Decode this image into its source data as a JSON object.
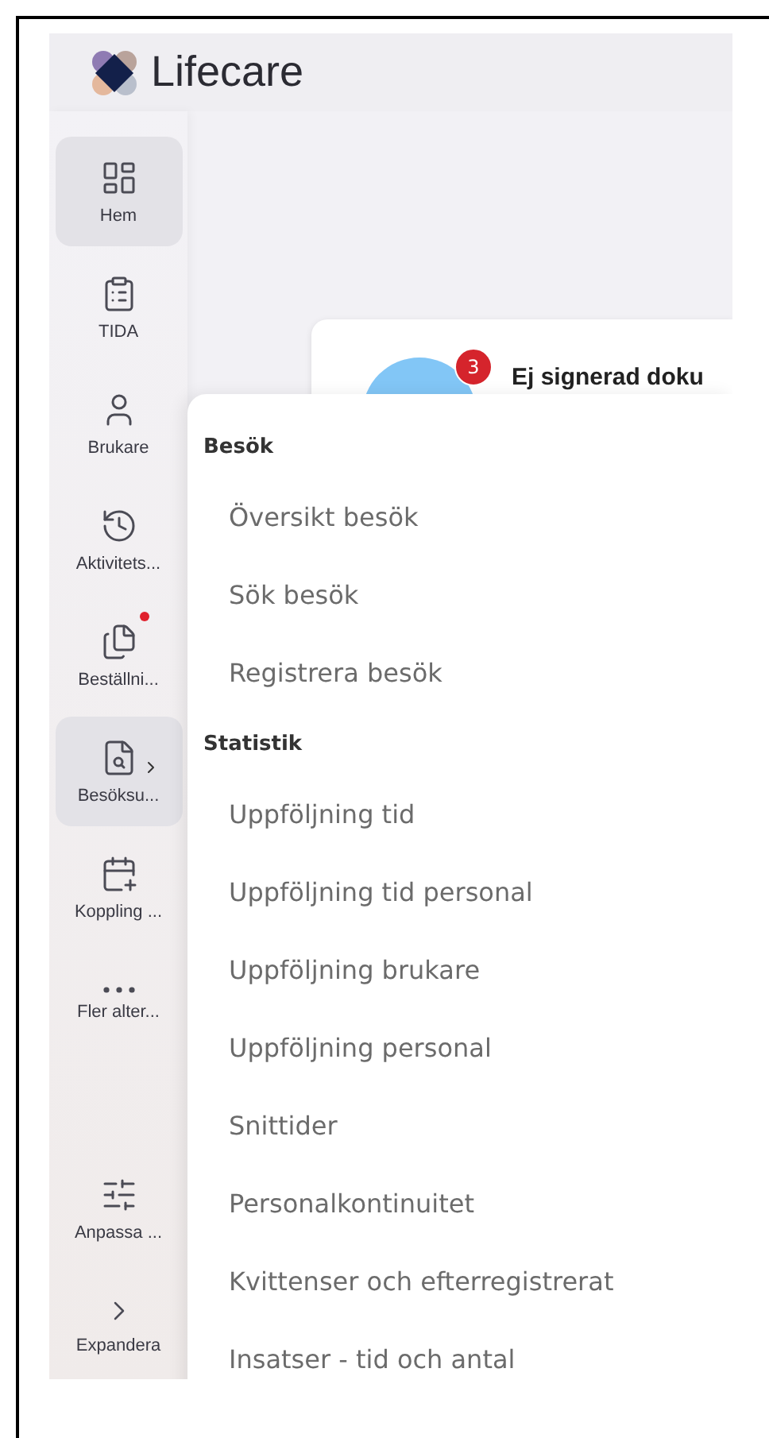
{
  "header": {
    "logo_text": "Lifecare"
  },
  "sidebar": {
    "items": [
      {
        "kind": "dashboard",
        "label": "Hem",
        "selected": true,
        "notification": false,
        "has_submenu": false
      },
      {
        "kind": "clipboard",
        "label": "TIDA",
        "selected": false,
        "notification": false,
        "has_submenu": false
      },
      {
        "kind": "user",
        "label": "Brukare",
        "selected": false,
        "notification": false,
        "has_submenu": false
      },
      {
        "kind": "history",
        "label": "Aktivitets...",
        "selected": false,
        "notification": false,
        "has_submenu": false
      },
      {
        "kind": "documents",
        "label": "Beställni...",
        "selected": false,
        "notification": true,
        "has_submenu": false
      },
      {
        "kind": "document-search",
        "label": "Besöksu...",
        "selected": true,
        "notification": false,
        "has_submenu": true
      },
      {
        "kind": "calendar-plus",
        "label": "Koppling ...",
        "selected": false,
        "notification": false,
        "has_submenu": false
      },
      {
        "kind": "more",
        "label": "Fler alter...",
        "selected": false,
        "notification": false,
        "has_submenu": false
      }
    ],
    "bottom_items": [
      {
        "kind": "sliders",
        "label": "Anpassa ..."
      },
      {
        "kind": "chevron",
        "label": "Expandera"
      }
    ]
  },
  "card": {
    "badge": "3",
    "title": "Ej signerad doku"
  },
  "menu": {
    "sections": [
      {
        "heading": "Besök",
        "items": [
          "Översikt besök",
          "Sök besök",
          "Registrera besök"
        ]
      },
      {
        "heading": "Statistik",
        "items": [
          "Uppföljning tid",
          "Uppföljning tid personal",
          "Uppföljning brukare",
          "Uppföljning personal",
          "Snittider",
          "Personalkontinuitet",
          "Kvittenser och efterregistrerat",
          "Insatser - tid och antal"
        ]
      }
    ]
  }
}
